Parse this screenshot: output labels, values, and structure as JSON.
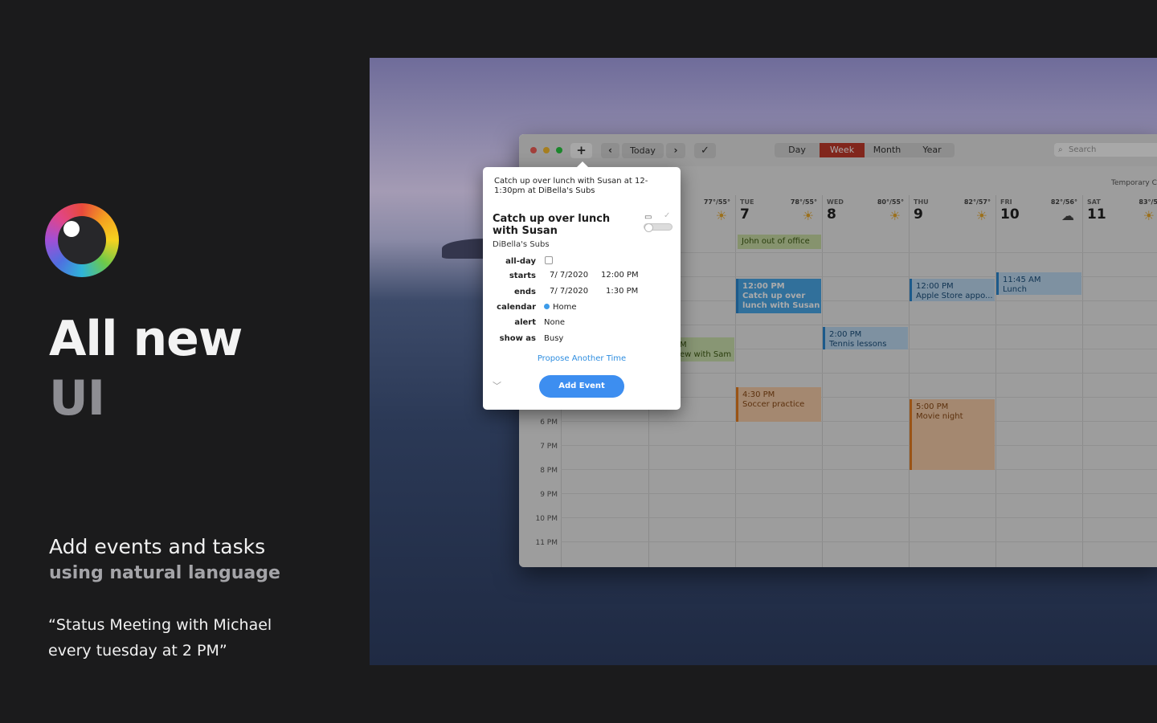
{
  "promo": {
    "headline_line1": "All new",
    "headline_line2": "UI",
    "subtitle_line1": "Add events and tasks",
    "subtitle_line2": "using natural language",
    "quote_line1": "“Status Meeting with Michael",
    "quote_line2": "every tuesday at 2 PM”"
  },
  "toolbar": {
    "add_label": "+",
    "prev_label": "‹",
    "today_label": "Today",
    "next_label": "›",
    "check_label": "✓",
    "views": [
      "Day",
      "Week",
      "Month",
      "Year"
    ],
    "active_view": "Week",
    "search_placeholder": "Search"
  },
  "calendar": {
    "temporary_label": "Temporary Ca",
    "days": [
      {
        "name": "",
        "num": "",
        "temp": "77°/55°",
        "icon": "sun-icon"
      },
      {
        "name": "TUE",
        "num": "7",
        "temp": "78°/55°",
        "icon": "sun-icon"
      },
      {
        "name": "WED",
        "num": "8",
        "temp": "80°/55°",
        "icon": "sun-icon"
      },
      {
        "name": "THU",
        "num": "9",
        "temp": "82°/57°",
        "icon": "sun-icon"
      },
      {
        "name": "FRI",
        "num": "10",
        "temp": "82°/56°",
        "icon": "cloud-icon"
      },
      {
        "name": "SAT",
        "num": "11",
        "temp": "83°/5",
        "icon": "sun-icon"
      }
    ],
    "time_labels": [
      "6 PM",
      "7 PM",
      "8 PM",
      "9 PM",
      "10 PM",
      "11 PM"
    ],
    "allday_event": "John out of office",
    "events": {
      "lunch_susan_time": "12:00 PM",
      "lunch_susan_title": "Catch up over",
      "lunch_susan_title2": "lunch with Susan",
      "tennis_time": "2:00 PM",
      "tennis_title": "Tennis lessons",
      "apple_time": "12:00 PM",
      "apple_title": "Apple Store appo...",
      "lunch_time": "11:45 AM",
      "lunch_title": "Lunch",
      "interview_time": "M",
      "interview_title": "ew with Sam",
      "soccer_time": "4:30 PM",
      "soccer_title": "Soccer practice",
      "movie_time": "5:00 PM",
      "movie_title": "Movie night"
    }
  },
  "popover": {
    "input_text": "Catch up over lunch with Susan at 12-1:30pm at DiBella's Subs",
    "event_title": "Catch up over lunch with Susan",
    "location": "DiBella's Subs",
    "labels": {
      "allday": "all-day",
      "starts": "starts",
      "ends": "ends",
      "calendar": "calendar",
      "alert": "alert",
      "show_as": "show as"
    },
    "starts_date": "7/  7/2020",
    "starts_time": "12:00 PM",
    "ends_date": "7/  7/2020",
    "ends_time": "1:30 PM",
    "calendar_value": "Home",
    "calendar_color": "#3d9be9",
    "alert_value": "None",
    "show_as_value": "Busy",
    "propose_label": "Propose Another Time",
    "add_event_label": "Add Event",
    "chevron": "﹀"
  }
}
